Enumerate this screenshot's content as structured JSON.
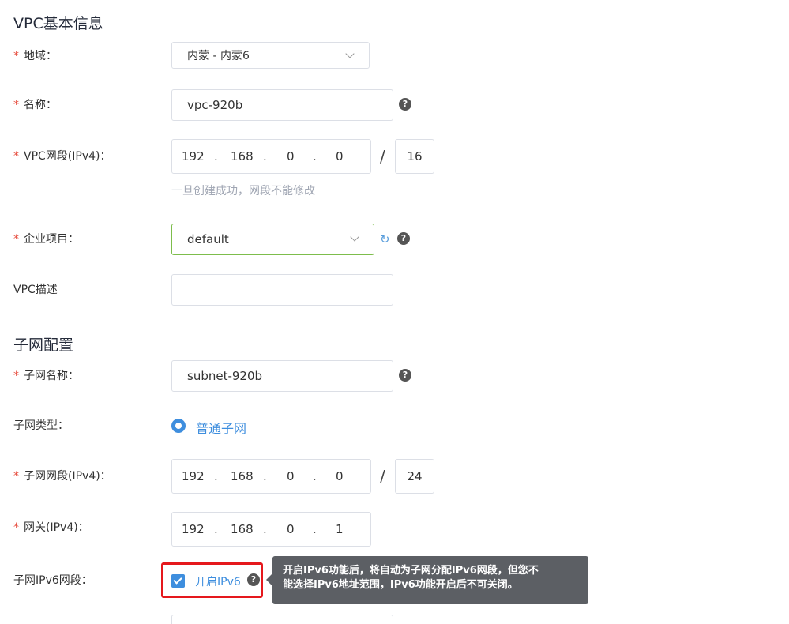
{
  "vpc_section": {
    "title": "VPC基本信息",
    "region": {
      "label": "地域：",
      "value": "内蒙 - 内蒙6"
    },
    "name": {
      "label": "名称：",
      "value": "vpc-920b"
    },
    "cidr": {
      "label": "VPC网段(IPv4)：",
      "octets": [
        "192",
        "168",
        "0",
        "0"
      ],
      "dot": ".",
      "slash": "/",
      "mask": "16",
      "hint": "一旦创建成功，网段不能修改"
    },
    "project": {
      "label": "企业项目：",
      "value": "default"
    },
    "description": {
      "label": "VPC描述",
      "value": ""
    }
  },
  "subnet_section": {
    "title": "子网配置",
    "name": {
      "label": "子网名称：",
      "value": "subnet-920b"
    },
    "type": {
      "label": "子网类型：",
      "option": "普通子网"
    },
    "cidr": {
      "label": "子网网段(IPv4)：",
      "octets": [
        "192",
        "168",
        "0",
        "0"
      ],
      "dot": ".",
      "slash": "/",
      "mask": "24"
    },
    "gateway": {
      "label": "网关(IPv4)：",
      "octets": [
        "192",
        "168",
        "0",
        "1"
      ],
      "dot": "."
    },
    "ipv6": {
      "label": "子网IPv6网段：",
      "checkbox_label": "开启IPv6",
      "checked": true,
      "tooltip_line1": "开启IPv6功能后，将自动为子网分配IPv6网段，但您不",
      "tooltip_line2": "能选择IPv6地址范围，IPv6功能开启后不可关闭。"
    }
  },
  "required_mark": "*",
  "help_glyph": "?",
  "refresh_glyph": "↻",
  "colors": {
    "accent": "#3e8ede",
    "required": "#e64a3b",
    "highlight": "#e5181d",
    "project_border": "#7dbd4c"
  }
}
